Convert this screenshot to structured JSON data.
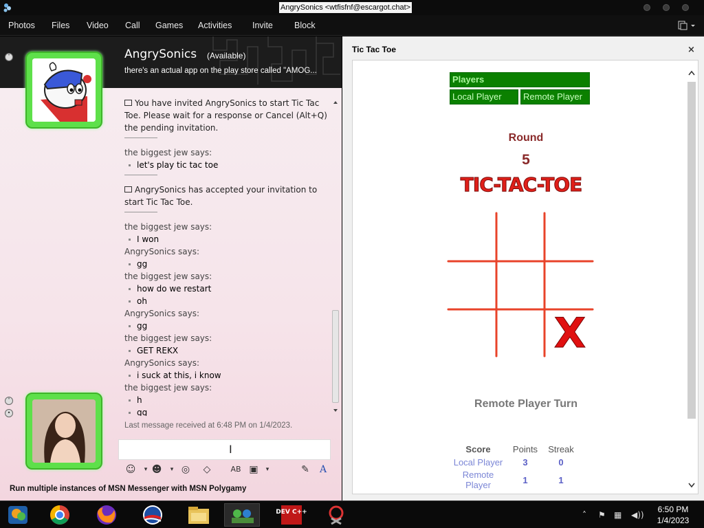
{
  "window": {
    "title": "AngrySonics <wtfisfnf@escargot.chat>"
  },
  "menu": [
    "Photos",
    "Files",
    "Video",
    "Call",
    "Games",
    "Activities",
    "Invite",
    "Block"
  ],
  "contact": {
    "name": "AngrySonics",
    "status": "(Available)",
    "personal_message": "there's an actual app on the play store called \"AMOG..."
  },
  "conversation": {
    "invite_sent": "You have invited AngrySonics to start Tic Tac Toe. Please wait for a response or Cancel (Alt+Q) the pending invitation.",
    "block1_sender": "the biggest jew says:",
    "block1_msgs": [
      "let's play tic tac toe"
    ],
    "invite_accepted": "AngrySonics has accepted your invitation to start Tic Tac Toe.",
    "block2_sender": "the biggest jew says:",
    "block2_msgs": [
      "I won"
    ],
    "block3_sender": "AngrySonics says:",
    "block3_msgs": [
      "gg"
    ],
    "block4_sender": "the biggest jew says:",
    "block4_msgs": [
      "how do we restart",
      "oh"
    ],
    "block5_sender": "AngrySonics says:",
    "block5_msgs": [
      "gg"
    ],
    "block6_sender": "the biggest jew says:",
    "block6_msgs": [
      "GET REKX"
    ],
    "block7_sender": "AngrySonics says:",
    "block7_msgs": [
      "i suck at this, i know"
    ],
    "block8_sender": "the biggest jew says:",
    "block8_msgs": [
      "h",
      "gg"
    ]
  },
  "last_message": "Last message received at 6:48 PM on 1/4/2023.",
  "promo": "Run multiple instances of MSN Messenger with MSN Polygamy",
  "game": {
    "title": "Tic Tac Toe",
    "close": "×",
    "players_label": "Players",
    "local_player": "Local Player",
    "remote_player": "Remote Player",
    "round_label": "Round",
    "round_number": "5",
    "logo_text": "TIC-TAC-TOE",
    "board": [
      "",
      "",
      "",
      "",
      "",
      "",
      "",
      "",
      "X"
    ],
    "turn_status": "Remote Player Turn",
    "score": {
      "headers": [
        "Score",
        "Points",
        "Streak"
      ],
      "rows": [
        {
          "name": "Local Player",
          "points": "3",
          "streak": "0"
        },
        {
          "name": "Remote Player",
          "points": "1",
          "streak": "1"
        }
      ]
    }
  },
  "taskbar": {
    "apps": [
      "windows-live-messenger-icon",
      "chrome-icon",
      "firefox-icon",
      "obama-logo-icon",
      "file-explorer-icon",
      "network-icon",
      "devcpp-icon",
      "snipping-tool-icon"
    ],
    "devcpp_label": "DEV C++",
    "time": "6:50 PM",
    "date": "1/4/2023"
  },
  "colors": {
    "game_green": "#0b8000",
    "board_red": "#e8432a",
    "x_red": "#e01010",
    "round_red": "#8a2a2a"
  }
}
